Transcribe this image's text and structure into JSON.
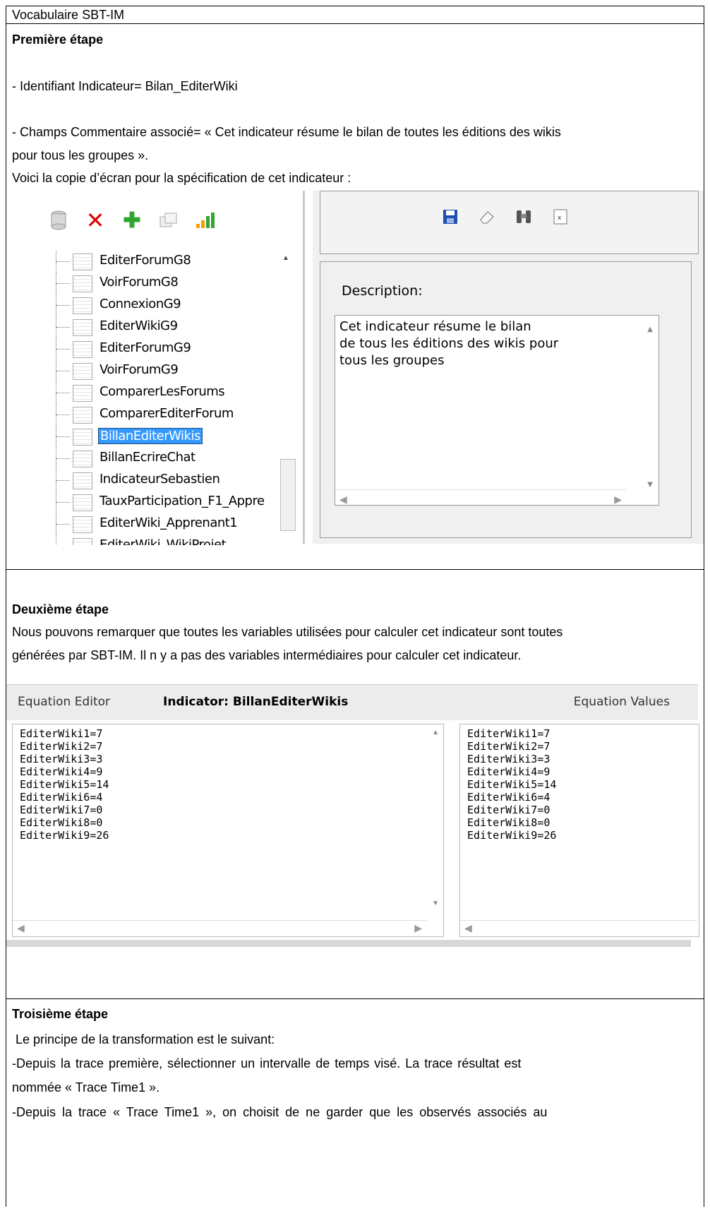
{
  "header": {
    "title": "Vocabulaire SBT-IM"
  },
  "step1": {
    "title": "Première étape",
    "line1": "- Identifiant Indicateur= Bilan_EditerWiki",
    "line2a": "- Champs Commentaire associé= « Cet indicateur résume le bilan de toutes les éditions des wikis",
    "line2b": "pour tous les groupes ».",
    "line3": "Voici la copie d’écran pour la spécification de cet indicateur :",
    "screenshot": {
      "toolbar_icons": [
        "database-icon",
        "delete-icon",
        "add-icon",
        "copy-icon",
        "chart-icon"
      ],
      "tree_items": [
        "EditerForumG8",
        "VoirForumG8",
        "ConnexionG9",
        "EditerWikiG9",
        "EditerForumG9",
        "VoirForumG9",
        "ComparerLesForums",
        "ComparerEditerForum",
        "BillanEditerWikis",
        "BillanEcrireChat",
        "IndicateurSebastien",
        "TauxParticipation_F1_Appre",
        "EditerWiki_Apprenant1",
        "EditerWiki_WikiProjet"
      ],
      "selected_index": 8,
      "right_toolbar_icons": [
        "save-icon",
        "eraser-icon",
        "binoculars-icon",
        "excel-icon"
      ],
      "description_label": "Description:",
      "description_lines": [
        "Cet indicateur résume le bilan",
        "de tous les éditions des wikis pour",
        "tous les groupes"
      ]
    }
  },
  "step2": {
    "title": "Deuxième étape",
    "para_a": "Nous pouvons remarquer que toutes les variables utilisées pour calculer cet indicateur sont toutes",
    "para_b": "générées par SBT-IM. Il n y a pas des variables intermédiaires pour calculer cet indicateur.",
    "screenshot": {
      "equation_editor_label": "Equation Editor",
      "indicator_label": "Indicator: BillanEditerWikis",
      "equation_values_label": "Equation Values",
      "equations": [
        "EditerWiki1=7",
        "EditerWiki2=7",
        "EditerWiki3=3",
        "EditerWiki4=9",
        "EditerWiki5=14",
        "EditerWiki6=4",
        "EditerWiki7=0",
        "EditerWiki8=0",
        "EditerWiki9=26"
      ],
      "values": [
        "EditerWiki1=7",
        "EditerWiki2=7",
        "EditerWiki3=3",
        "EditerWiki4=9",
        "EditerWiki5=14",
        "EditerWiki6=4",
        "EditerWiki7=0",
        "EditerWiki8=0",
        "EditerWiki9=26"
      ]
    }
  },
  "step3": {
    "title": "Troisième étape",
    "line1": " Le principe de la transformation est le suivant:",
    "line2": "-Depuis la trace première, sélectionner un intervalle de temps visé. La trace résultat est",
    "line3": "nommée « Trace Time1 ».",
    "line4": "-Depuis la trace « Trace Time1 », on choisit de ne garder que les observés associés au"
  }
}
